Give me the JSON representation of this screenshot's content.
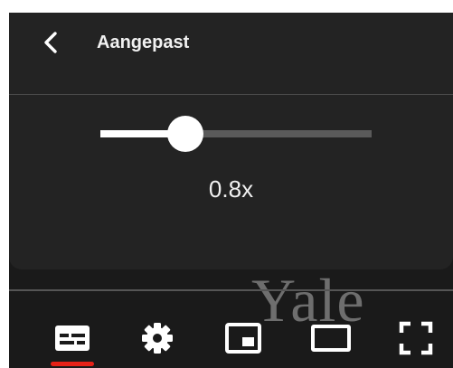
{
  "speed_panel": {
    "title": "Aangepast",
    "speed_label": "0.8x",
    "slider": {
      "value": 0.8,
      "min": 0.25,
      "max": 2.0
    }
  },
  "video": {
    "watermark": "Yale"
  },
  "controls": {
    "items": [
      {
        "icon": "subtitles-icon",
        "active": true
      },
      {
        "icon": "gear-icon",
        "active": false
      },
      {
        "icon": "miniplayer-icon",
        "active": false
      },
      {
        "icon": "theater-mode-icon",
        "active": false
      },
      {
        "icon": "fullscreen-icon",
        "active": false
      }
    ]
  },
  "colors": {
    "panel_background": "#232323",
    "text": "#f1f1f1",
    "slider_fill": "#ffffff",
    "slider_track": "#5a5a5a",
    "captions_active": "#e62117"
  }
}
